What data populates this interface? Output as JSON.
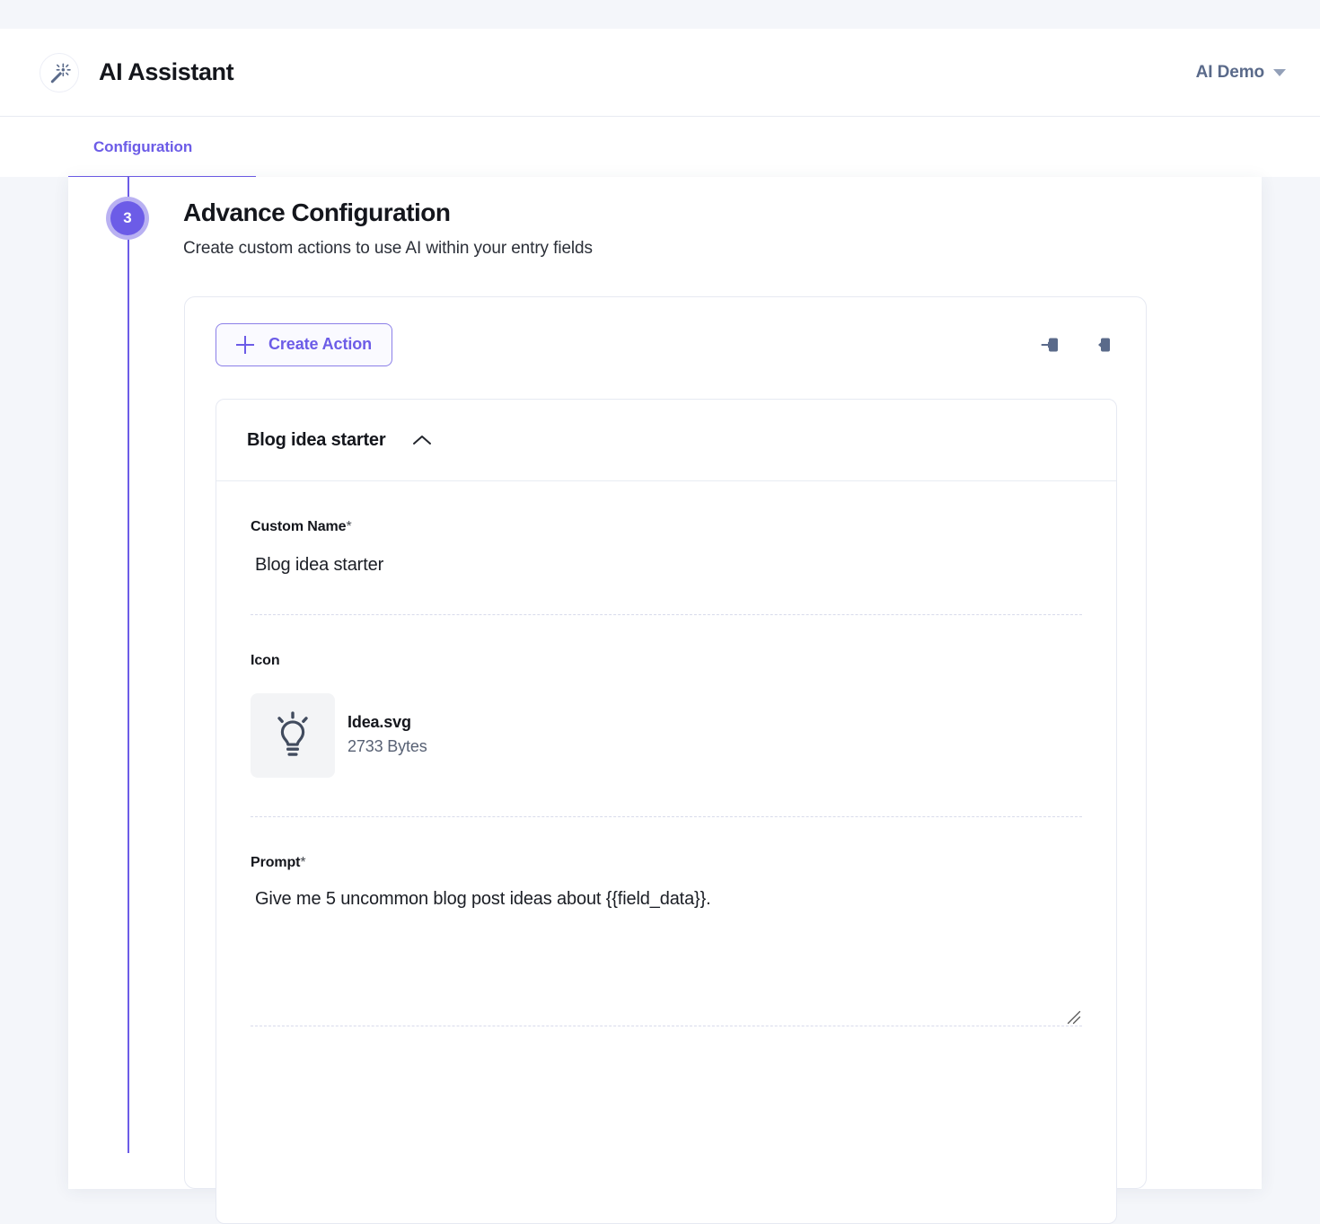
{
  "theme": {
    "accent": "#6c5ce7",
    "accent_soft": "#b9b1f2",
    "page_bg": "#f4f6fa",
    "panel_bg": "#ffffff",
    "icon_slate": "#5a6a8a",
    "border": "#e6e9f2"
  },
  "appbar": {
    "logo_icon": "magic-wand-icon",
    "title": "AI Assistant",
    "org": {
      "label": "AI Demo",
      "caret_icon": "chevron-down-icon"
    }
  },
  "tabs": [
    {
      "label": "Configuration",
      "active": true
    }
  ],
  "step": {
    "number": "3",
    "title": "Advance Configuration",
    "subtitle": "Create custom actions to use AI within your entry fields"
  },
  "toolbar": {
    "create_action_label": "Create Action",
    "create_action_icon": "plus-icon",
    "import_icon": "import-icon",
    "export_icon": "export-icon"
  },
  "action": {
    "name": "Blog idea starter",
    "collapse_icon": "chevron-up-icon",
    "expanded": true,
    "fields": {
      "custom_name": {
        "label": "Custom Name",
        "required_mark": "*",
        "value": "Blog idea starter"
      },
      "icon": {
        "label": "Icon",
        "thumb_icon": "lightbulb-icon",
        "file_name": "Idea.svg",
        "file_size": "2733 Bytes"
      },
      "prompt": {
        "label": "Prompt",
        "required_mark": "*",
        "value": "Give me 5 uncommon blog post ideas about {{field_data}}.",
        "resize_handle_icon": "resize-grip-icon"
      }
    }
  }
}
